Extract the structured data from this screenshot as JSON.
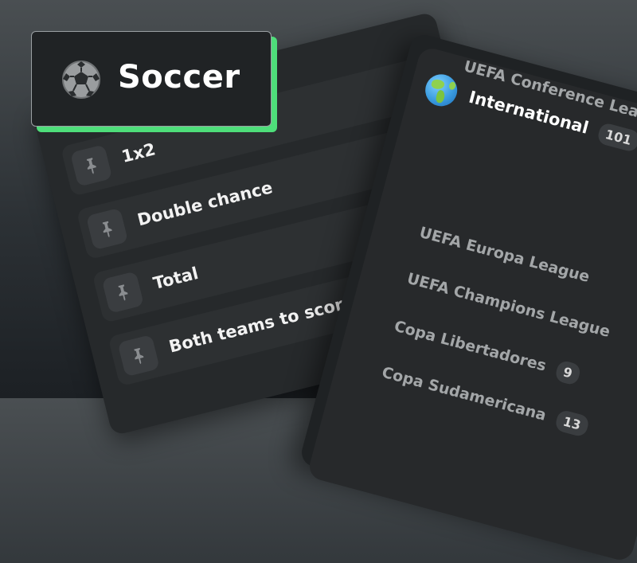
{
  "header": {
    "title": "Soccer",
    "icon": "soccer-ball-icon"
  },
  "markets": {
    "items": [
      {
        "label": "1x2",
        "icon": "pin-icon"
      },
      {
        "label": "Double chance",
        "icon": "pin-icon"
      },
      {
        "label": "Total",
        "icon": "pin-icon"
      },
      {
        "label": "Both teams to score",
        "icon": "pin-icon"
      }
    ]
  },
  "leagues": {
    "region": {
      "name": "International",
      "count": "101",
      "icon": "globe-icon"
    },
    "items": [
      {
        "name": "UEFA Europa League",
        "count": ""
      },
      {
        "name": "UEFA Champions League",
        "count": ""
      },
      {
        "name": "Copa Libertadores",
        "count": "9"
      },
      {
        "name": "Copa Sudamericana",
        "count": "13"
      },
      {
        "name": "UEFA Conference League",
        "count": ""
      }
    ]
  },
  "colors": {
    "accent": "#4ede7a",
    "panel": "#26292b",
    "text": "#ffffff",
    "muted": "#a3a6a8"
  }
}
